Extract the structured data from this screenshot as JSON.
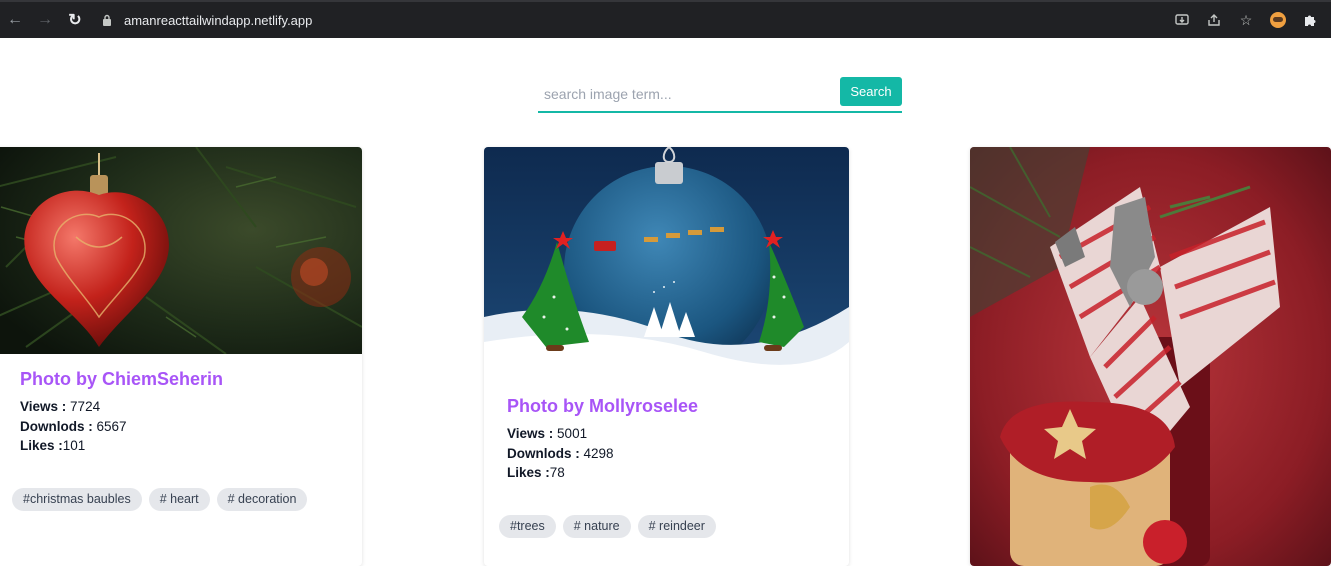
{
  "browser": {
    "url": "amanreacttailwindapp.netlify.app"
  },
  "search": {
    "placeholder": "search image term...",
    "button_label": "Search",
    "accent_color": "#14b8a6"
  },
  "cards": [
    {
      "author": "Photo by ChiemSeherin",
      "views_label": "Views :",
      "views": "7724",
      "downloads_label": "Downlods :",
      "downloads": "6567",
      "likes_label": "Likes :",
      "likes": "101",
      "tags": [
        "#christmas baubles",
        "# heart",
        "# decoration"
      ]
    },
    {
      "author": "Photo by Mollyroselee",
      "views_label": "Views :",
      "views": "5001",
      "downloads_label": "Downlods :",
      "downloads": "4298",
      "likes_label": "Likes :",
      "likes": "78",
      "tags": [
        "#trees",
        "# nature",
        "# reindeer"
      ]
    }
  ],
  "icons": {
    "back": "arrow-left-icon",
    "forward": "arrow-right-icon",
    "reload": "reload-icon",
    "lock": "lock-icon",
    "install": "install-icon",
    "share": "share-icon",
    "bookmark": "star-icon",
    "profile": "avatar",
    "extensions": "puzzle-icon"
  },
  "colors": {
    "author": "#a855f7",
    "tag_bg": "#e5e7eb"
  }
}
